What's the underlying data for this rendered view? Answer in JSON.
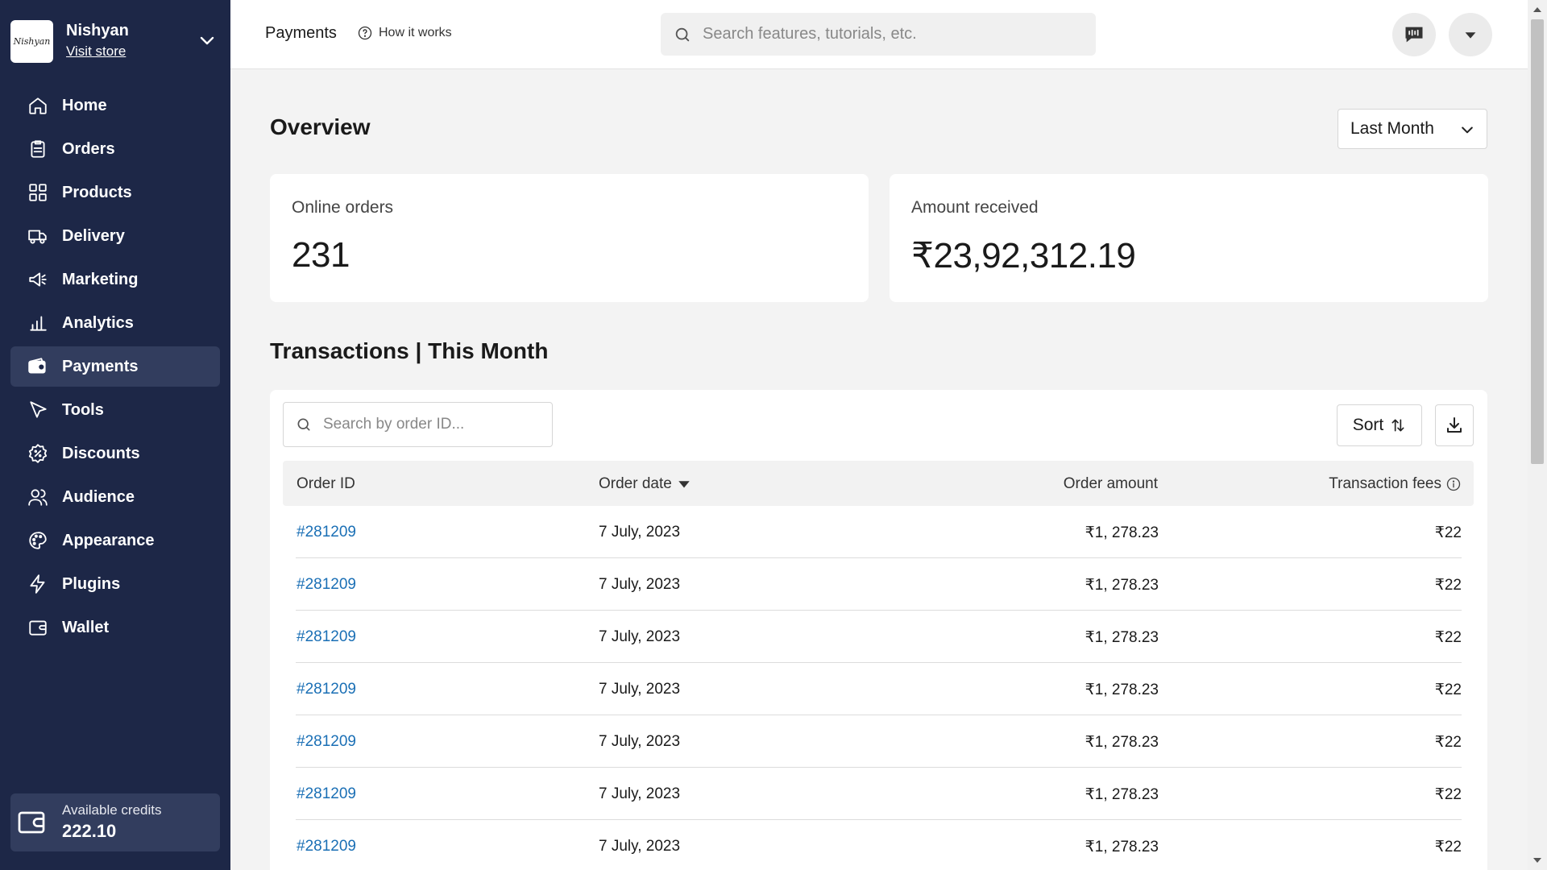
{
  "store": {
    "name": "Nishyan",
    "visit_label": "Visit store",
    "logo_text": "Nishyan"
  },
  "sidebar": {
    "items": [
      {
        "label": "Home",
        "icon": "home-icon",
        "active": false
      },
      {
        "label": "Orders",
        "icon": "orders-icon",
        "active": false
      },
      {
        "label": "Products",
        "icon": "products-icon",
        "active": false
      },
      {
        "label": "Delivery",
        "icon": "truck-icon",
        "active": false
      },
      {
        "label": "Marketing",
        "icon": "megaphone-icon",
        "active": false
      },
      {
        "label": "Analytics",
        "icon": "bar-chart-icon",
        "active": false
      },
      {
        "label": "Payments",
        "icon": "payments-icon",
        "active": true
      },
      {
        "label": "Tools",
        "icon": "cursor-icon",
        "active": false
      },
      {
        "label": "Discounts",
        "icon": "discount-icon",
        "active": false
      },
      {
        "label": "Audience",
        "icon": "users-icon",
        "active": false
      },
      {
        "label": "Appearance",
        "icon": "palette-icon",
        "active": false
      },
      {
        "label": "Plugins",
        "icon": "bolt-icon",
        "active": false
      },
      {
        "label": "Wallet",
        "icon": "wallet-icon",
        "active": false
      }
    ]
  },
  "credits": {
    "label": "Available credits",
    "value": "222.10"
  },
  "topbar": {
    "title": "Payments",
    "how_label": "How it works",
    "search_placeholder": "Search features, tutorials, etc."
  },
  "overview": {
    "title": "Overview",
    "period": "Last Month",
    "cards": [
      {
        "label": "Online orders",
        "value": "231"
      },
      {
        "label": "Amount received",
        "value": "₹23,92,312.19"
      }
    ]
  },
  "transactions": {
    "title": "Transactions | This Month",
    "search_placeholder": "Search by order ID...",
    "sort_label": "Sort",
    "columns": {
      "order_id": "Order ID",
      "order_date": "Order date",
      "order_amount": "Order amount",
      "transaction_fees": "Transaction fees"
    },
    "rows": [
      {
        "id": "#281209",
        "date": "7 July, 2023",
        "amount": "₹1, 278.23",
        "fees": "₹22"
      },
      {
        "id": "#281209",
        "date": "7 July, 2023",
        "amount": "₹1, 278.23",
        "fees": "₹22"
      },
      {
        "id": "#281209",
        "date": "7 July, 2023",
        "amount": "₹1, 278.23",
        "fees": "₹22"
      },
      {
        "id": "#281209",
        "date": "7 July, 2023",
        "amount": "₹1, 278.23",
        "fees": "₹22"
      },
      {
        "id": "#281209",
        "date": "7 July, 2023",
        "amount": "₹1, 278.23",
        "fees": "₹22"
      },
      {
        "id": "#281209",
        "date": "7 July, 2023",
        "amount": "₹1, 278.23",
        "fees": "₹22"
      },
      {
        "id": "#281209",
        "date": "7 July, 2023",
        "amount": "₹1, 278.23",
        "fees": "₹22"
      }
    ]
  },
  "colors": {
    "sidebar_bg": "#1d2747",
    "sidebar_active": "#323d5e",
    "link": "#1a6fb5",
    "page_bg": "#f3f3f3"
  }
}
